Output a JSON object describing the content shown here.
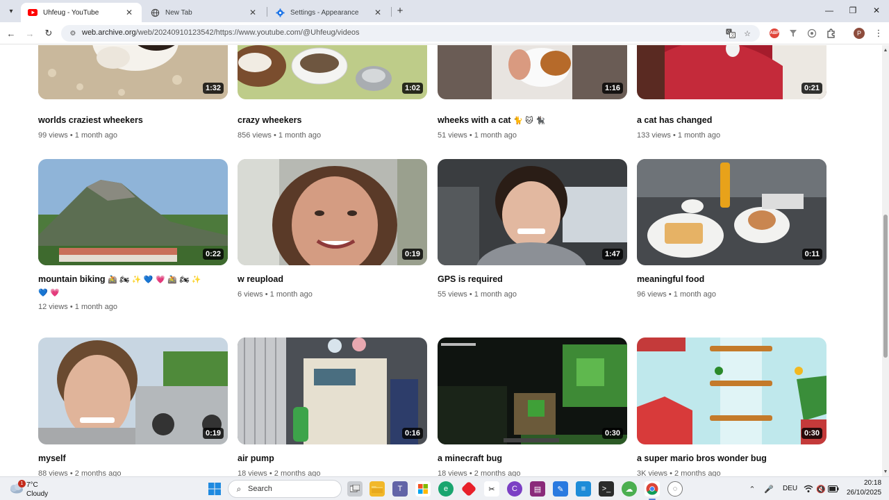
{
  "browser": {
    "tabs": [
      {
        "title": "Uhfeug - YouTube",
        "icon": "youtube-icon",
        "active": true
      },
      {
        "title": "New Tab",
        "icon": "globe-icon",
        "active": false
      },
      {
        "title": "Settings - Appearance",
        "icon": "gear-icon",
        "active": false
      }
    ],
    "url_host": "web.archive.org",
    "url_path": "/web/20240910123542/https://www.youtube.com/@Uhfeug/videos",
    "profile_initial": "P",
    "abp_label": "ABP"
  },
  "videos": [
    {
      "title": "worlds craziest wheekers",
      "views": "99 views",
      "age": "1 month ago",
      "duration": "1:32",
      "emoji": ""
    },
    {
      "title": "crazy wheekers",
      "views": "856 views",
      "age": "1 month ago",
      "duration": "1:02",
      "emoji": ""
    },
    {
      "title": "wheeks with a cat",
      "views": "51 views",
      "age": "1 month ago",
      "duration": "1:16",
      "emoji": "🐈 🐱 🐈‍⬛"
    },
    {
      "title": "a cat has changed",
      "views": "133 views",
      "age": "1 month ago",
      "duration": "0:21",
      "emoji": ""
    },
    {
      "title": "mountain biking",
      "views": "12 views",
      "age": "1 month ago",
      "duration": "0:22",
      "emoji": "🚵 🏍 ✨ 💙 💗 🚵 🏍 ✨",
      "emoji2": "💙 💗"
    },
    {
      "title": "w reupload",
      "views": "6 views",
      "age": "1 month ago",
      "duration": "0:19",
      "emoji": ""
    },
    {
      "title": "GPS is required",
      "views": "55 views",
      "age": "1 month ago",
      "duration": "1:47",
      "emoji": ""
    },
    {
      "title": "meaningful food",
      "views": "96 views",
      "age": "1 month ago",
      "duration": "0:11",
      "emoji": ""
    },
    {
      "title": "myself",
      "views": "88 views",
      "age": "2 months ago",
      "duration": "0:19",
      "emoji": ""
    },
    {
      "title": "air pump",
      "views": "18 views",
      "age": "2 months ago",
      "duration": "0:16",
      "emoji": ""
    },
    {
      "title": "a minecraft bug",
      "views": "18 views",
      "age": "2 months ago",
      "duration": "0:30",
      "emoji": ""
    },
    {
      "title": "a super mario bros wonder bug",
      "views": "3K views",
      "age": "2 months ago",
      "duration": "0:30",
      "emoji": ""
    }
  ],
  "meta_separator": "•",
  "taskbar": {
    "weather_temp": "7°C",
    "weather_condition": "Cloudy",
    "weather_badge": "1",
    "search_label": "Search",
    "language": "DEU",
    "time": "20:18",
    "date": "26/10/2025"
  }
}
